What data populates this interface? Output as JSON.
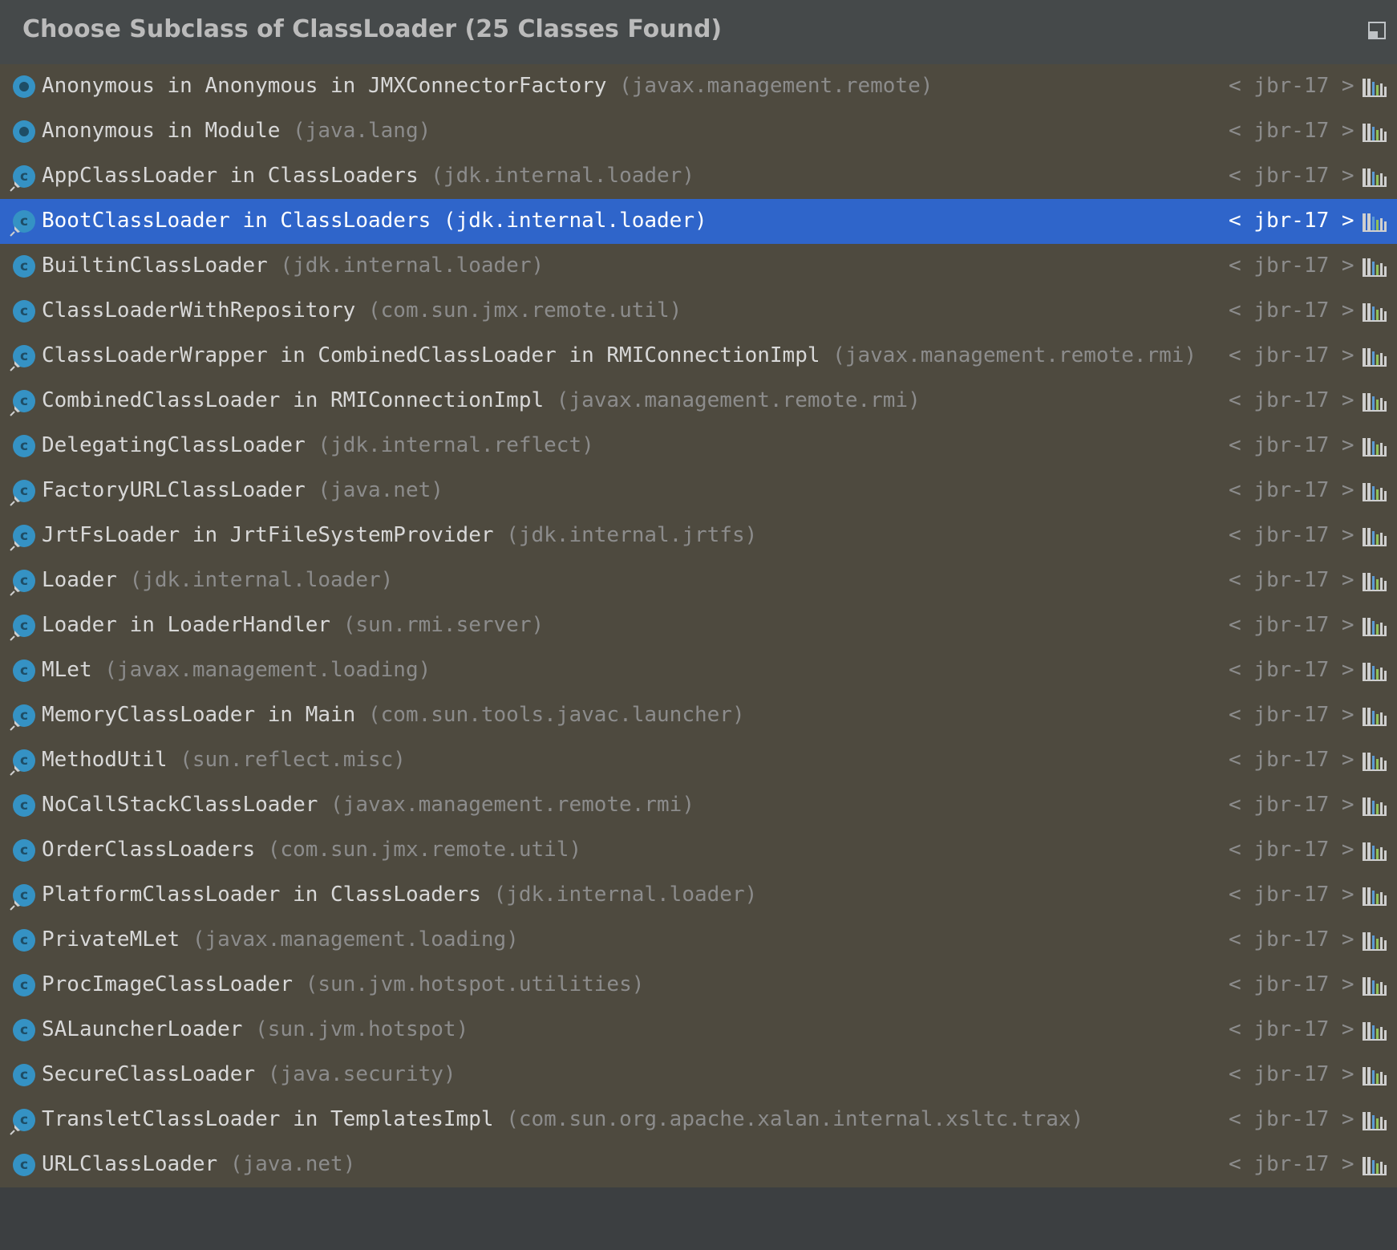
{
  "dialog": {
    "title": "Choose Subclass of ClassLoader (25 Classes Found)"
  },
  "colors": {
    "selection": "#2f65ca",
    "list_bg": "#4e4a3f",
    "header_bg": "#45494a",
    "class_icon": "#3592c4"
  },
  "rows": [
    {
      "name": "Anonymous in Anonymous in JMXConnectorFactory",
      "pkg": "(javax.management.remote)",
      "jdk": "< jbr-17 >",
      "icon": "anonymous-class-icon",
      "pinned": false,
      "selected": false
    },
    {
      "name": "Anonymous in Module",
      "pkg": "(java.lang)",
      "jdk": "< jbr-17 >",
      "icon": "anonymous-class-icon",
      "pinned": false,
      "selected": false
    },
    {
      "name": "AppClassLoader in ClassLoaders",
      "pkg": "(jdk.internal.loader)",
      "jdk": "< jbr-17 >",
      "icon": "class-icon",
      "pinned": true,
      "selected": false
    },
    {
      "name": "BootClassLoader in ClassLoaders",
      "pkg": "(jdk.internal.loader)",
      "jdk": "< jbr-17 >",
      "icon": "class-icon",
      "pinned": true,
      "selected": true
    },
    {
      "name": "BuiltinClassLoader",
      "pkg": "(jdk.internal.loader)",
      "jdk": "< jbr-17 >",
      "icon": "class-icon",
      "pinned": false,
      "selected": false
    },
    {
      "name": "ClassLoaderWithRepository",
      "pkg": "(com.sun.jmx.remote.util)",
      "jdk": "< jbr-17 >",
      "icon": "class-icon",
      "pinned": false,
      "selected": false
    },
    {
      "name": "ClassLoaderWrapper in CombinedClassLoader in RMIConnectionImpl",
      "pkg": "(javax.management.remote.rmi)",
      "jdk": "< jbr-17 >",
      "icon": "class-icon",
      "pinned": true,
      "selected": false
    },
    {
      "name": "CombinedClassLoader in RMIConnectionImpl",
      "pkg": "(javax.management.remote.rmi)",
      "jdk": "< jbr-17 >",
      "icon": "class-icon",
      "pinned": true,
      "selected": false
    },
    {
      "name": "DelegatingClassLoader",
      "pkg": "(jdk.internal.reflect)",
      "jdk": "< jbr-17 >",
      "icon": "class-icon",
      "pinned": false,
      "selected": false
    },
    {
      "name": "FactoryURLClassLoader",
      "pkg": "(java.net)",
      "jdk": "< jbr-17 >",
      "icon": "class-icon",
      "pinned": true,
      "selected": false
    },
    {
      "name": "JrtFsLoader in JrtFileSystemProvider",
      "pkg": "(jdk.internal.jrtfs)",
      "jdk": "< jbr-17 >",
      "icon": "class-icon",
      "pinned": true,
      "selected": false
    },
    {
      "name": "Loader",
      "pkg": "(jdk.internal.loader)",
      "jdk": "< jbr-17 >",
      "icon": "class-icon",
      "pinned": true,
      "selected": false
    },
    {
      "name": "Loader in LoaderHandler",
      "pkg": "(sun.rmi.server)",
      "jdk": "< jbr-17 >",
      "icon": "class-icon",
      "pinned": true,
      "selected": false
    },
    {
      "name": "MLet",
      "pkg": "(javax.management.loading)",
      "jdk": "< jbr-17 >",
      "icon": "class-icon",
      "pinned": false,
      "selected": false
    },
    {
      "name": "MemoryClassLoader in Main",
      "pkg": "(com.sun.tools.javac.launcher)",
      "jdk": "< jbr-17 >",
      "icon": "class-icon",
      "pinned": true,
      "selected": false
    },
    {
      "name": "MethodUtil",
      "pkg": "(sun.reflect.misc)",
      "jdk": "< jbr-17 >",
      "icon": "class-icon",
      "pinned": true,
      "selected": false
    },
    {
      "name": "NoCallStackClassLoader",
      "pkg": "(javax.management.remote.rmi)",
      "jdk": "< jbr-17 >",
      "icon": "class-icon",
      "pinned": false,
      "selected": false
    },
    {
      "name": "OrderClassLoaders",
      "pkg": "(com.sun.jmx.remote.util)",
      "jdk": "< jbr-17 >",
      "icon": "class-icon",
      "pinned": false,
      "selected": false
    },
    {
      "name": "PlatformClassLoader in ClassLoaders",
      "pkg": "(jdk.internal.loader)",
      "jdk": "< jbr-17 >",
      "icon": "class-icon",
      "pinned": true,
      "selected": false
    },
    {
      "name": "PrivateMLet",
      "pkg": "(javax.management.loading)",
      "jdk": "< jbr-17 >",
      "icon": "class-icon",
      "pinned": false,
      "selected": false
    },
    {
      "name": "ProcImageClassLoader",
      "pkg": "(sun.jvm.hotspot.utilities)",
      "jdk": "< jbr-17 >",
      "icon": "class-icon",
      "pinned": false,
      "selected": false
    },
    {
      "name": "SALauncherLoader",
      "pkg": "(sun.jvm.hotspot)",
      "jdk": "< jbr-17 >",
      "icon": "class-icon",
      "pinned": false,
      "selected": false
    },
    {
      "name": "SecureClassLoader",
      "pkg": "(java.security)",
      "jdk": "< jbr-17 >",
      "icon": "class-icon",
      "pinned": false,
      "selected": false
    },
    {
      "name": "TransletClassLoader in TemplatesImpl",
      "pkg": "(com.sun.org.apache.xalan.internal.xsltc.trax)",
      "jdk": "< jbr-17 >",
      "icon": "class-icon",
      "pinned": true,
      "selected": false
    },
    {
      "name": "URLClassLoader",
      "pkg": "(java.net)",
      "jdk": "< jbr-17 >",
      "icon": "class-icon",
      "pinned": false,
      "selected": false
    }
  ]
}
